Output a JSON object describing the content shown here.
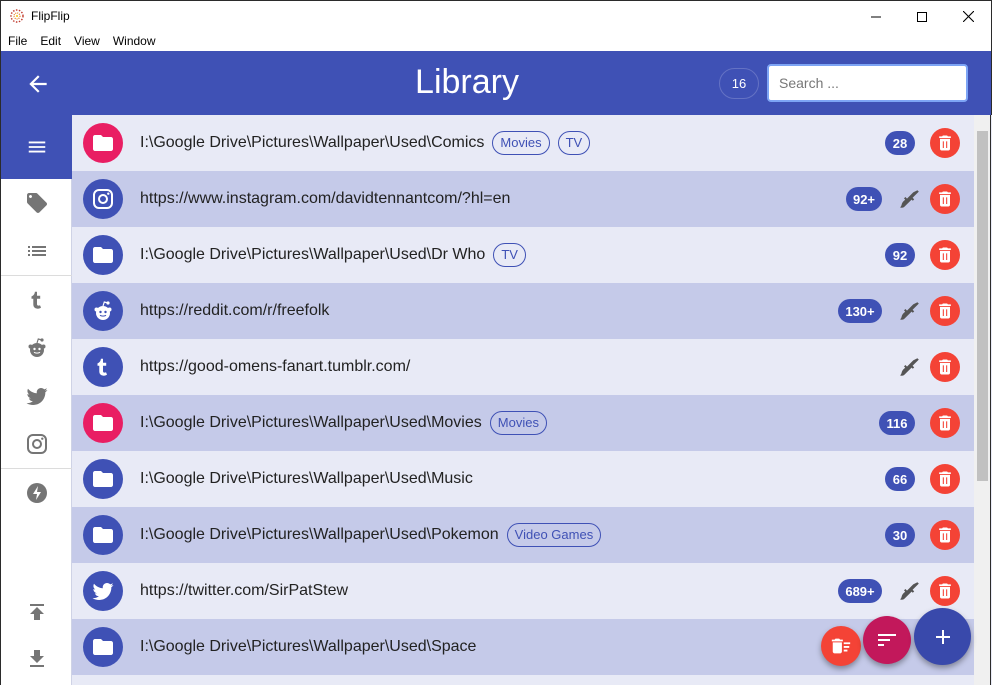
{
  "window": {
    "title": "FlipFlip"
  },
  "menu": [
    "File",
    "Edit",
    "View",
    "Window"
  ],
  "header": {
    "title": "Library",
    "count": "16",
    "search_placeholder": "Search ..."
  },
  "sidebar": {
    "items": [
      "menu-icon",
      "tag-icon",
      "list-icon",
      "tumblr-icon",
      "reddit-icon",
      "twitter-icon",
      "instagram-icon",
      "lightning-icon",
      "upload-icon",
      "download-icon"
    ]
  },
  "colors": {
    "primary": "#3f51b5",
    "pink": "#e91e63",
    "red": "#f44336",
    "row_light": "#e8eaf6",
    "row_dark": "#c5cae9"
  },
  "rows": [
    {
      "url": "I:\\Google Drive\\Pictures\\Wallpaper\\Used\\Comics",
      "icon": "folder-icon",
      "avatar_color": "#e91e63",
      "tags": [
        "Movies",
        "TV"
      ],
      "count": "28",
      "clean": false
    },
    {
      "url": "https://www.instagram.com/davidtennantcom/?hl=en",
      "icon": "instagram-icon",
      "avatar_color": "#3f51b5",
      "tags": [],
      "count": "92+",
      "clean": true
    },
    {
      "url": "I:\\Google Drive\\Pictures\\Wallpaper\\Used\\Dr Who",
      "icon": "folder-icon",
      "avatar_color": "#3f51b5",
      "tags": [
        "TV"
      ],
      "count": "92",
      "clean": false
    },
    {
      "url": "https://reddit.com/r/freefolk",
      "icon": "reddit-icon",
      "avatar_color": "#3f51b5",
      "tags": [],
      "count": "130+",
      "clean": true
    },
    {
      "url": "https://good-omens-fanart.tumblr.com/",
      "icon": "tumblr-icon",
      "avatar_color": "#3f51b5",
      "tags": [],
      "count": "",
      "clean": true
    },
    {
      "url": "I:\\Google Drive\\Pictures\\Wallpaper\\Used\\Movies",
      "icon": "folder-icon",
      "avatar_color": "#e91e63",
      "tags": [
        "Movies"
      ],
      "count": "116",
      "clean": false
    },
    {
      "url": "I:\\Google Drive\\Pictures\\Wallpaper\\Used\\Music",
      "icon": "folder-icon",
      "avatar_color": "#3f51b5",
      "tags": [],
      "count": "66",
      "clean": false
    },
    {
      "url": "I:\\Google Drive\\Pictures\\Wallpaper\\Used\\Pokemon",
      "icon": "folder-icon",
      "avatar_color": "#3f51b5",
      "tags": [
        "Video Games"
      ],
      "count": "30",
      "clean": false
    },
    {
      "url": "https://twitter.com/SirPatStew",
      "icon": "twitter-icon",
      "avatar_color": "#3f51b5",
      "tags": [],
      "count": "689+",
      "clean": true
    },
    {
      "url": "I:\\Google Drive\\Pictures\\Wallpaper\\Used\\Space",
      "icon": "folder-icon",
      "avatar_color": "#3f51b5",
      "tags": [],
      "count": "",
      "clean": false
    }
  ]
}
